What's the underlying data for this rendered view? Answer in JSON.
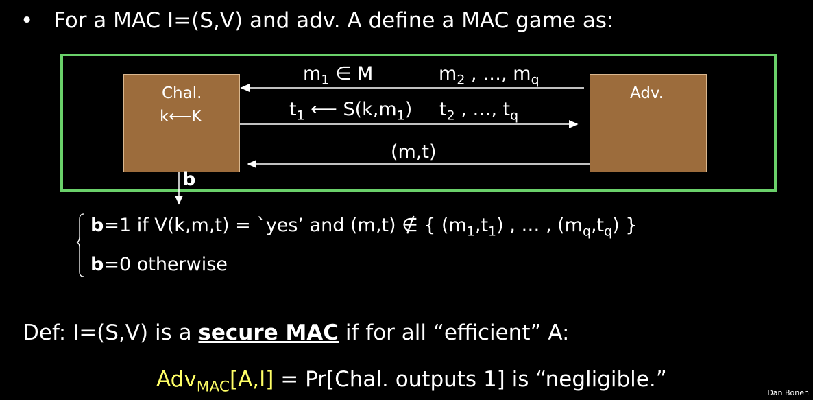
{
  "slide": {
    "bullet": {
      "glyph": "•",
      "text": "For a MAC   I=(S,V)  and adv.  A  define a MAC game as:"
    },
    "game": {
      "frame_color": "#6ad06a",
      "challenger": {
        "line1": "Chal.",
        "line2": "k⟵K"
      },
      "adversary": {
        "label": "Adv."
      },
      "arrow1": {
        "m1": "m",
        "m1_sub": "1",
        "in_m": "∈ M",
        "mq": "m",
        "mq_sub": "2",
        "mq_rest": ", …, m",
        "mq_sub_q": "q"
      },
      "arrow2": {
        "t1": "t",
        "t1_sub": "1",
        "t1_rest": " ⟵ S(k,m",
        "t1_sub2": "1",
        "t1_close": ")",
        "t2": "t",
        "t2_sub": "2",
        "t2_rest": ", …, t",
        "t2_sub_q": "q"
      },
      "arrow3": {
        "label": "(m,t)"
      },
      "output": {
        "label": "b"
      }
    },
    "conditions": {
      "line1": {
        "b": "b",
        "text_a": "=1   if  V(k,m,t) = `yes’   and  (m,t) ∉ { (m",
        "s1": "1",
        "text_b": ",t",
        "s2": "1",
        "text_c": ") , … , (m",
        "s3": "q",
        "text_d": ",t",
        "s4": "q",
        "text_e": ") }"
      },
      "line2": {
        "b": "b",
        "text": "=0   otherwise"
      }
    },
    "definition": {
      "prefix": "Def:  I=(S,V)  is a ",
      "emph": "secure MAC",
      "suffix": " if for all “efficient” A:"
    },
    "advantage": {
      "adv": "Adv",
      "adv_sub": "MAC",
      "adv_args": "[A,I]",
      "rest": "  =  Pr[Chal. outputs 1]      is “negligible.”"
    },
    "footer": {
      "author": "Dan Boneh"
    }
  }
}
